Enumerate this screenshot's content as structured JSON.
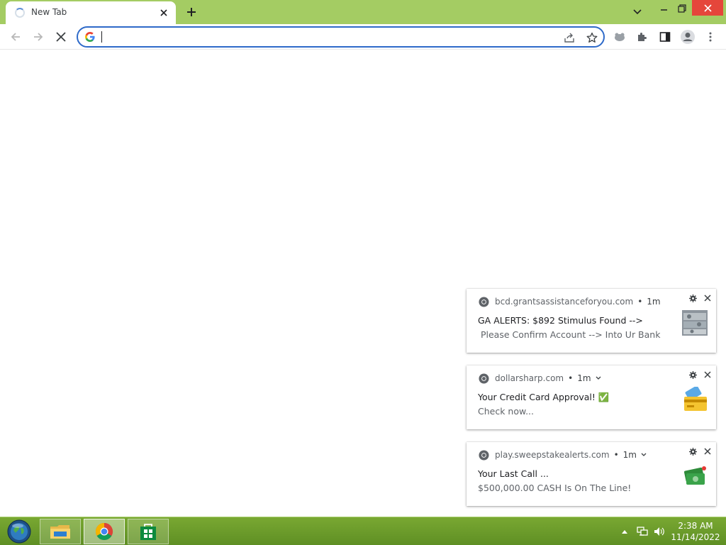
{
  "browser": {
    "tab": {
      "title": "New Tab"
    },
    "omnibox": {
      "value": "",
      "placeholder": ""
    }
  },
  "notifications": [
    {
      "origin": "bcd.grantsassistanceforyou.com",
      "time": "1m",
      "title": "GA ALERTS: $892 Stimulus Found -->",
      "body": " Please Confirm Account --> Into Ur Bank",
      "image_icon": "money-stack-image"
    },
    {
      "origin": "dollarsharp.com",
      "time": "1m",
      "title": "Your Credit Card Approval! ✅",
      "body": "Check now...",
      "image_icon": "credit-card-image"
    },
    {
      "origin": "play.sweepstakealerts.com",
      "time": "1m",
      "title": "Your Last Call ...",
      "body": "$500,000.00 CASH Is On The Line!",
      "image_icon": "cash-image"
    }
  ],
  "taskbar": {
    "apps": [
      "file-explorer",
      "chrome",
      "store"
    ],
    "clock_time": "2:38 AM",
    "clock_date": "11/14/2022"
  },
  "colors": {
    "frame": "#a4cc63",
    "omnibox_border": "#2e6ac9",
    "taskbar": "#6b9a2b",
    "close_button": "#e5463b"
  }
}
